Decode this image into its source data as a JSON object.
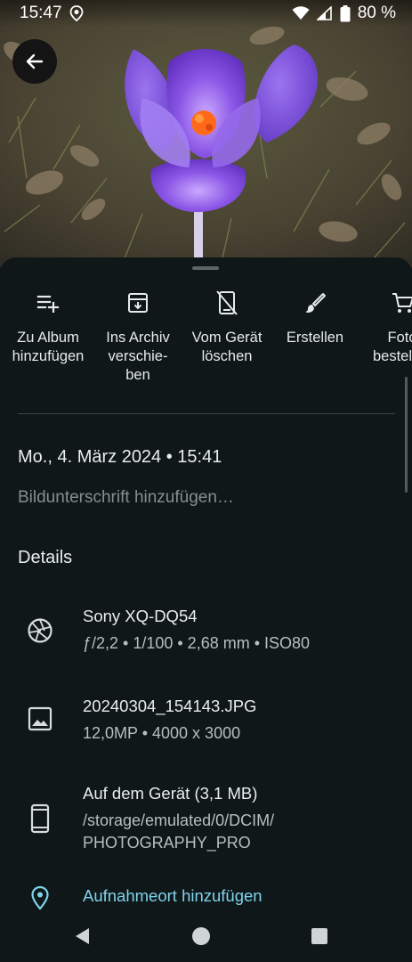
{
  "status_bar": {
    "time": "15:47",
    "battery": "80 %",
    "icons": [
      "location-icon",
      "wifi-icon",
      "signal-icon",
      "battery-icon"
    ]
  },
  "photo": {
    "subject": "purple-crocus-flower",
    "colors": {
      "petal": "#7b3fd6",
      "petal_light": "#b08cf0",
      "stamen": "#ff6a1a",
      "ground": "#4a4535"
    }
  },
  "actions": [
    {
      "label": "Zu Album\nhinzufügen",
      "icon": "playlist-add-icon"
    },
    {
      "label": "Ins Archiv\nverschie-\nben",
      "icon": "archive-icon"
    },
    {
      "label": "Vom Gerät\nlöschen",
      "icon": "delete-from-device-icon"
    },
    {
      "label": "Erstellen",
      "icon": "brush-icon"
    },
    {
      "label": "Foto\nbestellen",
      "icon": "cart-icon"
    }
  ],
  "info": {
    "date": "Mo., 4. März 2024 • 15:41",
    "caption_placeholder": "Bildunterschrift hinzufügen…",
    "details_heading": "Details"
  },
  "details": {
    "camera": {
      "title": "Sony XQ-DQ54",
      "sub": "ƒ/2,2 • 1/100 • 2,68 mm • ISO80"
    },
    "file": {
      "title": "20240304_154143.JPG",
      "sub": "12,0MP • 4000 x 3000"
    },
    "storage": {
      "title": "Auf dem Gerät (3,1 MB)",
      "sub": "/storage/emulated/0/DCIM/\nPHOTOGRAPHY_PRO"
    },
    "location": {
      "title": "Aufnahmeort hinzufügen"
    }
  },
  "colors": {
    "background": "#0f1719",
    "accent": "#7fd3ec",
    "text": "#e9edee",
    "muted": "#868e90"
  }
}
